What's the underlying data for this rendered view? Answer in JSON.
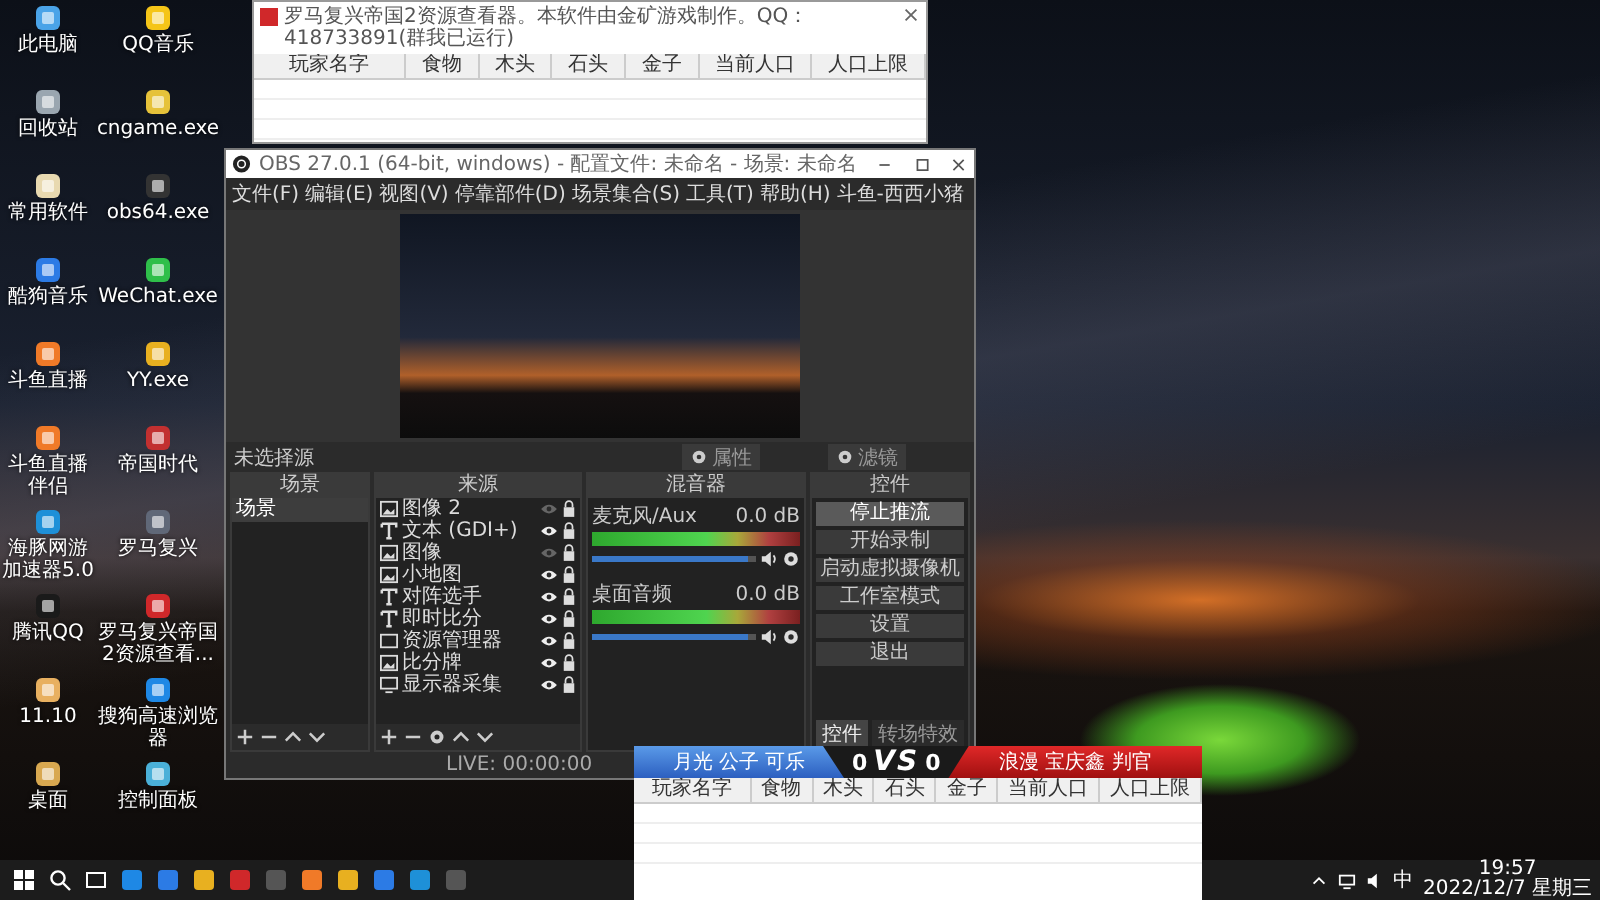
{
  "desktop_icons": [
    {
      "label": "此电脑"
    },
    {
      "label": "QQ音乐"
    },
    {
      "label": "回收站"
    },
    {
      "label": "cngame.exe"
    },
    {
      "label": "常用软件"
    },
    {
      "label": "obs64.exe"
    },
    {
      "label": "酷狗音乐"
    },
    {
      "label": "WeChat.exe"
    },
    {
      "label": "斗鱼直播"
    },
    {
      "label": "YY.exe"
    },
    {
      "label": "斗鱼直播伴侣"
    },
    {
      "label": "帝国时代"
    },
    {
      "label": "海豚网游加速器5.0"
    },
    {
      "label": "罗马复兴"
    },
    {
      "label": "腾讯QQ"
    },
    {
      "label": "罗马复兴帝国2资源查看..."
    },
    {
      "label": "11.10"
    },
    {
      "label": "搜狗高速浏览器"
    },
    {
      "label": "桌面"
    },
    {
      "label": "控制面板"
    }
  ],
  "resource_window": {
    "title": "罗马复兴帝国2资源查看器。本软件由金矿游戏制作。QQ：418733891(群我已运行)",
    "columns": [
      "玩家名字",
      "食物",
      "木头",
      "石头",
      "金子",
      "当前人口",
      "人口上限"
    ]
  },
  "obs": {
    "title": "OBS 27.0.1 (64-bit, windows) - 配置文件: 未命名 - 场景: 未命名",
    "menu": [
      "文件(F)",
      "编辑(E)",
      "视图(V)",
      "停靠部件(D)",
      "场景集合(S)",
      "工具(T)",
      "帮助(H)",
      "斗鱼-西西小猪"
    ],
    "source_bar": {
      "status": "未选择源",
      "buttons": [
        "属性",
        "滤镜"
      ]
    },
    "scenes": {
      "title": "场景",
      "items": [
        {
          "label": "场景",
          "selected": true
        }
      ]
    },
    "sources": {
      "title": "来源",
      "items": [
        {
          "label": "图像 2",
          "kind": "image",
          "visible": false
        },
        {
          "label": "文本 (GDI+)",
          "kind": "text",
          "visible": true
        },
        {
          "label": "图像",
          "kind": "image",
          "visible": false
        },
        {
          "label": "小地图",
          "kind": "image",
          "visible": true
        },
        {
          "label": "对阵选手",
          "kind": "text",
          "visible": true
        },
        {
          "label": "即时比分",
          "kind": "text",
          "visible": true
        },
        {
          "label": "资源管理器",
          "kind": "window",
          "visible": true
        },
        {
          "label": "比分牌",
          "kind": "image",
          "visible": true
        },
        {
          "label": "显示器采集",
          "kind": "display",
          "visible": true
        }
      ]
    },
    "mixer": {
      "title": "混音器",
      "channels": [
        {
          "name": "麦克风/Aux",
          "reading": "0.0 dB",
          "level": 0.95
        },
        {
          "name": "桌面音频",
          "reading": "0.0 dB",
          "level": 0.95
        }
      ]
    },
    "controls": {
      "title": "控件",
      "buttons": [
        {
          "label": "停止推流",
          "active": true
        },
        {
          "label": "开始录制",
          "active": false
        },
        {
          "label": "启动虚拟摄像机",
          "active": false
        },
        {
          "label": "工作室模式",
          "active": false
        },
        {
          "label": "设置",
          "active": false
        },
        {
          "label": "退出",
          "active": false
        }
      ],
      "tabs": [
        {
          "label": "控件",
          "selected": true
        },
        {
          "label": "转场特效",
          "selected": false
        }
      ]
    },
    "status": "LIVE: 00:00:00"
  },
  "scoreboard": {
    "left_team": "月光 公子 可乐",
    "left_score": "0",
    "vs": "VS",
    "right_score": "0",
    "right_team": "浪漫 宝庆鑫 判官",
    "columns": [
      "玩家名字",
      "食物",
      "木头",
      "石头",
      "金子",
      "当前人口",
      "人口上限"
    ]
  },
  "taskbar": {
    "input_method": "中",
    "time": "19:57",
    "date": "2022/12/7 星期三"
  }
}
